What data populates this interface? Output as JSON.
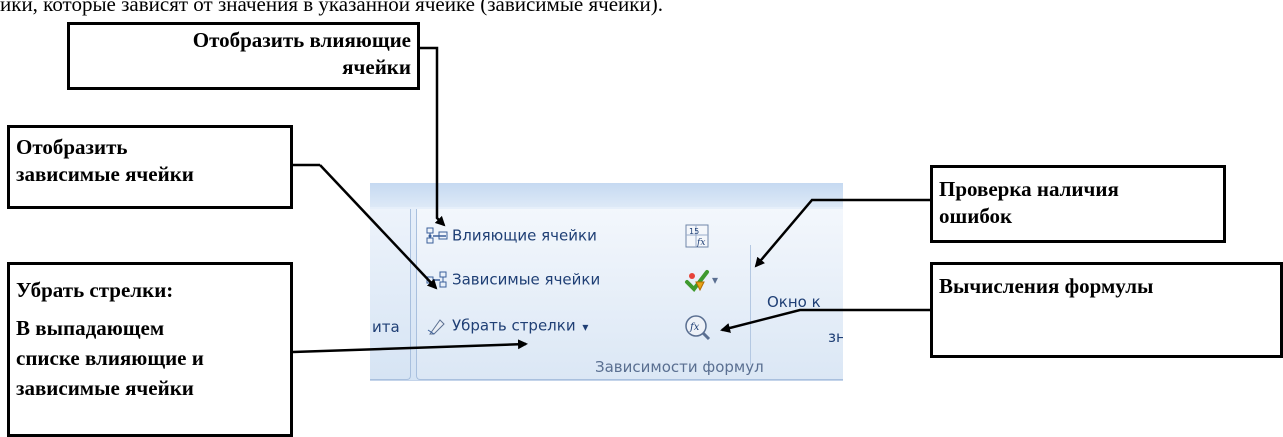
{
  "header_text": "ики, которые зависят от значения в указанной ячейке (зависимые ячейки).",
  "callouts": {
    "trace_precedents": {
      "lines": [
        "Отобразить влияющие",
        "ячейки"
      ]
    },
    "trace_dependents": {
      "lines": [
        "Отобразить",
        "зависимые ячейки"
      ]
    },
    "remove_arrows": {
      "lines": [
        "Убрать стрелки:",
        "В выпадающем",
        "списке влияющие и",
        "зависимые ячейки"
      ]
    },
    "error_checking": {
      "lines": [
        "Проверка наличия",
        "ошибок"
      ]
    },
    "evaluate_formula": {
      "lines": [
        "Вычисления формулы"
      ]
    }
  },
  "ribbon": {
    "precedents_label": "Влияющие ячейки",
    "dependents_label": "Зависимые ячейки",
    "remove_arrows_label": "Убрать стрелки",
    "dropdown_glyph": "▾",
    "left_group_partial": "ита",
    "watch_window_line1": "Окно к",
    "watch_window_line2": "зн",
    "group_label": "Зависимости формул",
    "show_formulas_icon_text": "15",
    "colors": {
      "ribbon_text": "#1f3f75",
      "group_label": "#5a6f91"
    }
  }
}
